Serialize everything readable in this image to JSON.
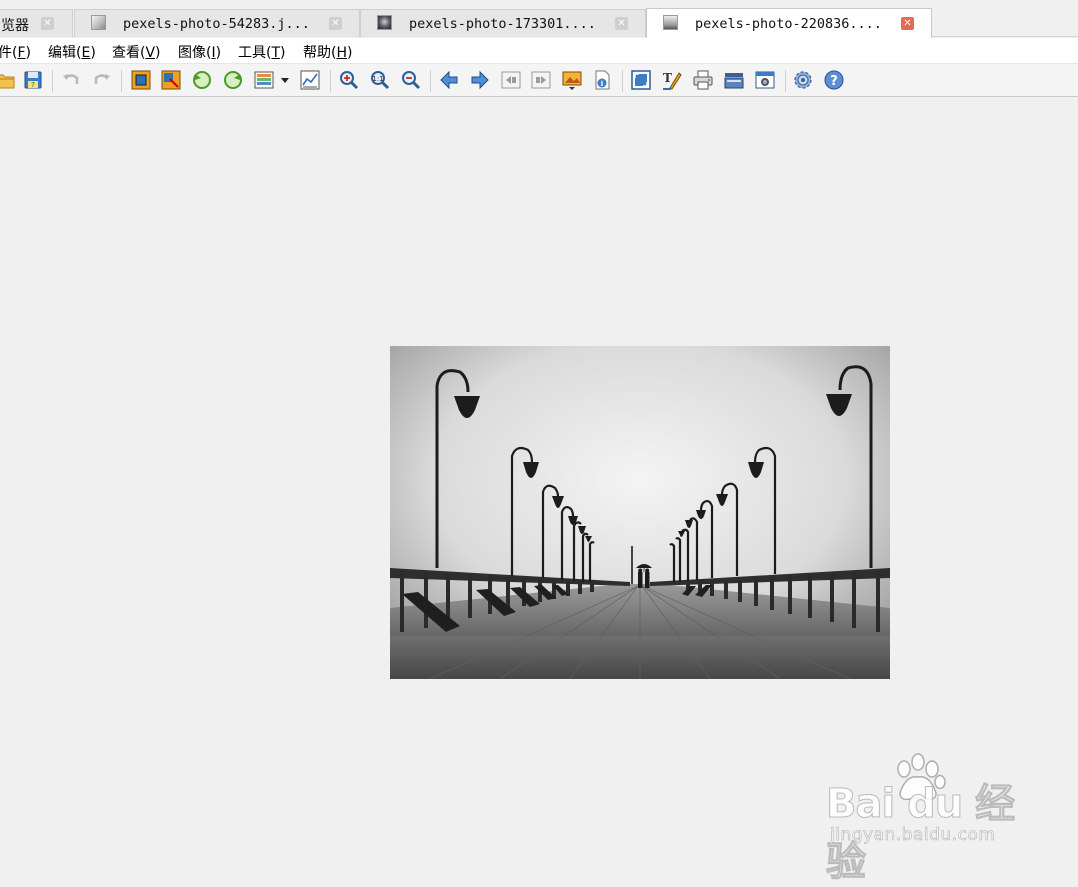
{
  "tabs": [
    {
      "label": "览器",
      "active": false
    },
    {
      "label": "pexels-photo-54283.j...",
      "active": false
    },
    {
      "label": "pexels-photo-173301....",
      "active": false
    },
    {
      "label": "pexels-photo-220836....",
      "active": true
    }
  ],
  "menu": {
    "items": [
      {
        "label": "件(",
        "key": "F",
        "end": ")"
      },
      {
        "label": "编辑(",
        "key": "E",
        "end": ")"
      },
      {
        "label": "查看(",
        "key": "V",
        "end": ")"
      },
      {
        "label": "图像(",
        "key": "I",
        "end": ")"
      },
      {
        "label": "工具(",
        "key": "T",
        "end": ")"
      },
      {
        "label": "帮助(",
        "key": "H",
        "end": ")"
      }
    ]
  },
  "toolbar": {
    "icons": [
      "open-folder-icon",
      "save-icon",
      "undo-icon",
      "redo-icon",
      "crop-icon",
      "resize-icon",
      "rotate-left-icon",
      "rotate-right-icon",
      "color-adjust-icon",
      "dropdown-arrow-icon",
      "histogram-icon",
      "zoom-in-icon",
      "zoom-actual-icon",
      "zoom-out-icon",
      "previous-icon",
      "next-icon",
      "first-icon",
      "last-icon",
      "slideshow-icon",
      "properties-icon",
      "fullscreen-icon",
      "text-edit-icon",
      "print-icon",
      "scan-icon",
      "capture-icon",
      "settings-icon",
      "help-icon"
    ]
  },
  "watermark": {
    "brand": "Bai du 经验",
    "sub": "jingyan.baidu.com"
  },
  "colors": {
    "active_close": "#e46b4f",
    "toolbar_blue": "#3b7dc4",
    "toolbar_orange": "#f0a020"
  }
}
